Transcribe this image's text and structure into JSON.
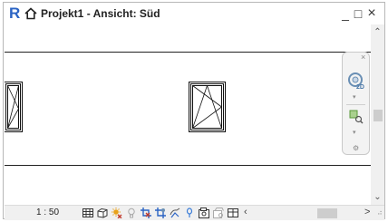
{
  "titlebar": {
    "app_logo": "R",
    "title": "Projekt1 - Ansicht: Süd",
    "minimize": "_",
    "maximize": "□",
    "close": "×"
  },
  "navbar": {
    "close": "×",
    "expand": "⌃",
    "options": "⚙"
  },
  "scrollbar": {
    "up": "⌃",
    "down": "⌄"
  },
  "statusbar": {
    "scale": "1 : 50",
    "scroll_left": "<",
    "scroll_right": ">",
    "resize_grip": "⠴"
  },
  "icons": {
    "app": "revit-logo-icon",
    "home": "home-icon",
    "wheel": "steering-wheel-icon",
    "zoom": "zoom-region-icon"
  },
  "colors": {
    "app_logo": "#2b64c4",
    "sun_icon": "#e8a21a",
    "crop_icon": "#c0392b",
    "wheel_icon": "#6a8fb4",
    "zoom_icon": "#5a9a3a"
  }
}
